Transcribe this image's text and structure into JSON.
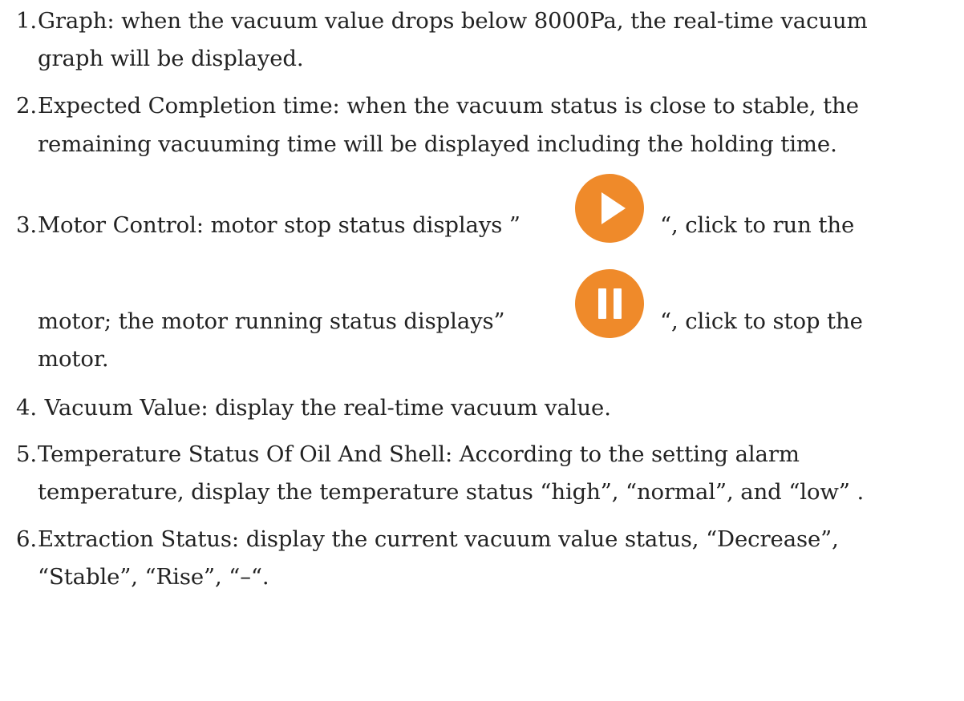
{
  "items": [
    {
      "number": "1.",
      "lines": [
        "Graph: when the vacuum value drops below 8000Pa, the real-time vacuum",
        "graph will be displayed."
      ]
    },
    {
      "number": "2.",
      "lines": [
        "Expected Completion time: when the vacuum status is close to stable, the",
        "remaining  vacuuming time will be displayed including the holding time."
      ]
    },
    {
      "number": "3.",
      "line1_before_icon": "Motor Control: motor stop status displays ”",
      "line1_after_icon": "“, click to run the",
      "line2_before_icon": "motor; the motor running status displays”",
      "line2_after_icon": "“, click to stop the",
      "line3": "motor.",
      "icon1": "play-icon",
      "icon2": "pause-icon",
      "icon_color": "#ef8a2a"
    },
    {
      "number": "4.",
      "lines": [
        " Vacuum Value: display the real-time vacuum value."
      ]
    },
    {
      "number": "5.",
      "lines": [
        "Temperature Status Of Oil And Shell: According to the setting alarm",
        "temperature, display the temperature status “high”, “normal”, and “low” ."
      ]
    },
    {
      "number": "6.",
      "lines": [
        "Extraction Status: display the current vacuum value status, “Decrease”,",
        "“Stable”, “Rise”, “–“."
      ]
    }
  ]
}
